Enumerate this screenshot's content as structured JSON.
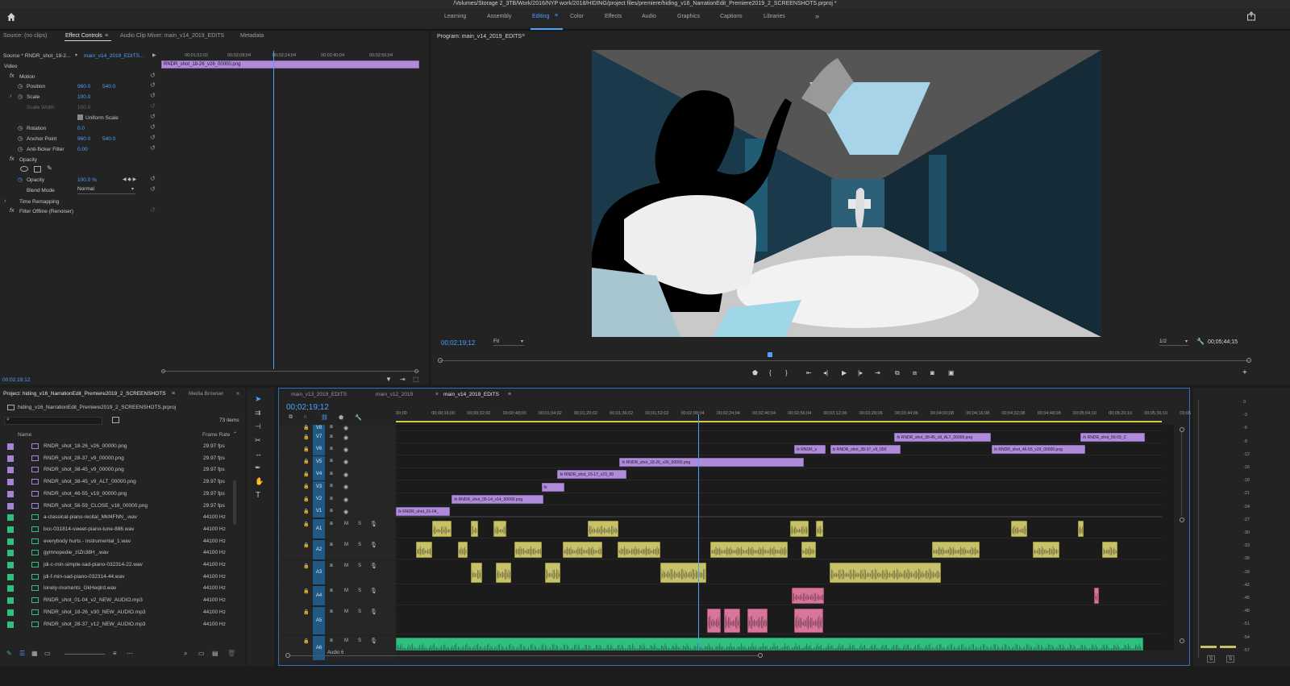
{
  "window_title": "/Volumes/Storage 2_3TB/Work/2016/NYP work/2018/HIDING/project files/premiere/hiding_v16_NarrationEdit_Premiere2019_2_SCREENSHOTS.prproj *",
  "workspaces": [
    {
      "label": "Learning",
      "active": false
    },
    {
      "label": "Assembly",
      "active": false
    },
    {
      "label": "Editing",
      "active": true
    },
    {
      "label": "Color",
      "active": false
    },
    {
      "label": "Effects",
      "active": false
    },
    {
      "label": "Audio",
      "active": false
    },
    {
      "label": "Graphics",
      "active": false
    },
    {
      "label": "Captions",
      "active": false
    },
    {
      "label": "Libraries",
      "active": false
    }
  ],
  "effect_panel": {
    "tabs": [
      "Source: (no clips)",
      "Effect Controls",
      "Audio Clip Mixer: main_v14_2019_EDITS",
      "Metadata"
    ],
    "source_label": "Source * RNDR_shot_18-2...",
    "sequence_label": "main_v14_2019_EDITS...",
    "ruler": [
      "00;01;52;02",
      "00;02;08;04",
      "00;02;24;04",
      "00;02;40;04",
      "00;02;56;04"
    ],
    "clip_name": "RNDR_shot_18-26_v26_00000.png",
    "section_video": "Video",
    "props": {
      "motion": "Motion",
      "position": "Position",
      "position_x": "960.0",
      "position_y": "540.0",
      "scale": "Scale",
      "scale_val": "100.0",
      "scale_width": "Scale Width",
      "scale_width_val": "100.0",
      "uniform": "Uniform Scale",
      "rotation": "Rotation",
      "rotation_val": "0.0",
      "anchor": "Anchor Point",
      "anchor_x": "960.0",
      "anchor_y": "540.0",
      "antiflicker": "Anti-flicker Filter",
      "antiflicker_val": "0.00",
      "opacity_group": "Opacity",
      "opacity": "Opacity",
      "opacity_val": "100.0 %",
      "blend": "Blend Mode",
      "blend_val": "Normal",
      "time_remap": "Time Remapping",
      "filter_offline": "Filter Offline (Renoiser)"
    },
    "timecode": "00;02;19;12"
  },
  "program": {
    "title": "Program: main_v14_2019_EDITS",
    "timecode": "00;02;19;12",
    "fit": "Fit",
    "resolution": "1/2",
    "duration": "00;05;44;15",
    "playhead": 0.405
  },
  "project": {
    "tabs": [
      "Project: hiding_v16_NarrationEdit_Premiere2019_2_SCREENSHOTS",
      "Media Browser"
    ],
    "file": "hiding_v16_NarrationEdit_Premiere2019_2_SCREENSHOTS.prproj",
    "count": "73 items",
    "col_name": "Name",
    "col_rate": "Frame Rate",
    "items": [
      {
        "name": "RNDR_shot_18-26_v26_00000.png",
        "rate": "29.97 fps",
        "type": "video"
      },
      {
        "name": "RNDR_shot_28-37_v9_00000.png",
        "rate": "29.97 fps",
        "type": "video"
      },
      {
        "name": "RNDR_shot_38-45_v9_00000.png",
        "rate": "29.97 fps",
        "type": "video"
      },
      {
        "name": "RNDR_shot_38-45_v9_ALT_00000.png",
        "rate": "29.97 fps",
        "type": "video"
      },
      {
        "name": "RNDR_shot_46-55_v19_00000.png",
        "rate": "29.97 fps",
        "type": "video"
      },
      {
        "name": "RNDR_shot_56-59_CLOSE_v16_00000.png",
        "rate": "29.97 fps",
        "type": "video"
      },
      {
        "name": "a-classical-piano-recital_Mkf4FNN_.wav",
        "rate": "44100 Hz",
        "type": "audio"
      },
      {
        "name": "bcc-031814-sweet-piano-tune-886.wav",
        "rate": "44100 Hz",
        "type": "audio"
      },
      {
        "name": "everybody hurts - instrumental_1.wav",
        "rate": "44100 Hz",
        "type": "audio"
      },
      {
        "name": "gymnopedie_zIZn38H_.wav",
        "rate": "44100 Hz",
        "type": "audio"
      },
      {
        "name": "jdi-c-min-simple-sad-piano-032314-22.wav",
        "rate": "44100 Hz",
        "type": "audio"
      },
      {
        "name": "jdi-f-min-sad-piano-032314-44.wav",
        "rate": "44100 Hz",
        "type": "audio"
      },
      {
        "name": "lonely-moments_GkHeqlrd.wav",
        "rate": "44100 Hz",
        "type": "audio"
      },
      {
        "name": "RNDR_shot_01-04_v2_NEW_AUDIO.mp3",
        "rate": "44100 Hz",
        "type": "audio"
      },
      {
        "name": "RNDR_shot_18-26_v30_NEW_AUDIO.mp3",
        "rate": "44100 Hz",
        "type": "audio"
      },
      {
        "name": "RNDR_shot_28-37_v12_NEW_AUDIO.mp3",
        "rate": "44100 Hz",
        "type": "audio"
      }
    ]
  },
  "timeline": {
    "tabs": [
      "main_v13_2019_EDITS",
      "main_v12_2019",
      "main_v14_2019_EDITS"
    ],
    "timecode": "00;02;19;12",
    "ruler": [
      "00;00",
      "00;00;16;00",
      "00;00;32;00",
      "00;00;48;00",
      "00;01;04;02",
      "00;01;20;02",
      "00;01;36;02",
      "00;01;52;02",
      "00;02;08;04",
      "00;02;24;04",
      "00;02;40;04",
      "00;02;56;04",
      "00;03;12;06",
      "00;03;28;06",
      "00;03;44;06",
      "00;04;00;08",
      "00;04;16;08",
      "00;04;32;08",
      "00;04;48;08",
      "00;05;04;10",
      "00;05;20;10",
      "00;05;36;10",
      "00;05"
    ],
    "video_tracks": [
      "V8",
      "V7",
      "V6",
      "V5",
      "V4",
      "V3",
      "V2",
      "V1"
    ],
    "audio_tracks": [
      "A1",
      "A2",
      "A3",
      "A4",
      "A5",
      "A6"
    ],
    "audio6_name": "Audio 6",
    "track_m": "M",
    "track_s": "S",
    "video_clips": [
      {
        "name": "RNDR_shot_38-45_v9_ALT_00000.png",
        "track": 1,
        "start": 0.651,
        "end": 0.777
      },
      {
        "name": "RNDR_shot_56-59_C",
        "track": 1,
        "start": 0.894,
        "end": 0.978
      },
      {
        "name": "RNDR_s",
        "track": 2,
        "start": 0.52,
        "end": 0.561
      },
      {
        "name": "RNDR_shot_28-37_v9_000",
        "track": 2,
        "start": 0.567,
        "end": 0.659
      },
      {
        "name": "RNDR_shot_46-55_v19_00000.png",
        "track": 2,
        "start": 0.778,
        "end": 0.9
      },
      {
        "name": "RNDR_shot_18-26_v26_00000.png",
        "track": 3,
        "start": 0.292,
        "end": 0.533
      },
      {
        "name": "RNDR_shot_15-17_v23_00",
        "track": 4,
        "start": 0.211,
        "end": 0.301
      },
      {
        "name": "",
        "track": 5,
        "start": 0.19,
        "end": 0.22
      },
      {
        "name": "RNDR_shot_05-14_v14_00000.png",
        "track": 6,
        "start": 0.073,
        "end": 0.193
      },
      {
        "name": "RNDR_shot_01-04_",
        "track": 7,
        "start": 0,
        "end": 0.071
      }
    ],
    "audio_clips": [
      {
        "track": 0,
        "start": 0.047,
        "end": 0.073,
        "color": "y"
      },
      {
        "track": 0,
        "start": 0.098,
        "end": 0.107,
        "color": "y"
      },
      {
        "track": 0,
        "start": 0.127,
        "end": 0.144,
        "color": "y"
      },
      {
        "track": 0,
        "start": 0.25,
        "end": 0.29,
        "color": "y"
      },
      {
        "track": 0,
        "start": 0.515,
        "end": 0.539,
        "color": "y"
      },
      {
        "track": 0,
        "start": 0.548,
        "end": 0.558,
        "color": "y"
      },
      {
        "track": 0,
        "start": 0.803,
        "end": 0.824,
        "color": "y"
      },
      {
        "track": 0,
        "start": 0.89,
        "end": 0.898,
        "color": "y"
      },
      {
        "track": 1,
        "start": 0.026,
        "end": 0.047,
        "color": "y"
      },
      {
        "track": 1,
        "start": 0.081,
        "end": 0.094,
        "color": "y"
      },
      {
        "track": 1,
        "start": 0.155,
        "end": 0.19,
        "color": "y"
      },
      {
        "track": 1,
        "start": 0.218,
        "end": 0.269,
        "color": "y"
      },
      {
        "track": 1,
        "start": 0.289,
        "end": 0.345,
        "color": "y"
      },
      {
        "track": 1,
        "start": 0.41,
        "end": 0.512,
        "color": "y"
      },
      {
        "track": 1,
        "start": 0.529,
        "end": 0.548,
        "color": "y"
      },
      {
        "track": 1,
        "start": 0.7,
        "end": 0.762,
        "color": "y"
      },
      {
        "track": 1,
        "start": 0.832,
        "end": 0.866,
        "color": "y"
      },
      {
        "track": 1,
        "start": 0.922,
        "end": 0.942,
        "color": "y"
      },
      {
        "track": 2,
        "start": 0.098,
        "end": 0.113,
        "color": "y"
      },
      {
        "track": 2,
        "start": 0.13,
        "end": 0.15,
        "color": "y"
      },
      {
        "track": 2,
        "start": 0.195,
        "end": 0.215,
        "color": "y"
      },
      {
        "track": 2,
        "start": 0.345,
        "end": 0.405,
        "color": "y"
      },
      {
        "track": 2,
        "start": 0.566,
        "end": 0.712,
        "color": "y"
      },
      {
        "track": 3,
        "start": 0.517,
        "end": 0.559,
        "color": "p"
      },
      {
        "track": 3,
        "start": 0.912,
        "end": 0.918,
        "color": "p"
      },
      {
        "track": 4,
        "start": 0.406,
        "end": 0.424,
        "color": "p"
      },
      {
        "track": 4,
        "start": 0.428,
        "end": 0.45,
        "color": "p"
      },
      {
        "track": 4,
        "start": 0.459,
        "end": 0.485,
        "color": "p"
      },
      {
        "track": 4,
        "start": 0.52,
        "end": 0.558,
        "color": "p"
      },
      {
        "track": 5,
        "start": 0,
        "end": 0.976,
        "color": "g"
      }
    ],
    "playhead": 0.395,
    "db_scale": [
      "0",
      "-3",
      "-6",
      "-9",
      "-12",
      "-15",
      "-18",
      "-21",
      "-24",
      "-27",
      "-30",
      "-33",
      "-36",
      "-39",
      "-42",
      "-45",
      "-48",
      "-51",
      "-54",
      "-57"
    ],
    "meter_s": "S"
  },
  "colors": {
    "accent": "#4ea2ff",
    "video_clip": "#b08bd9",
    "audio_clip": "#c7c16a",
    "pink_clip": "#d9749a",
    "green_clip": "#2fbf7f",
    "track_label": "#1f5a86"
  }
}
